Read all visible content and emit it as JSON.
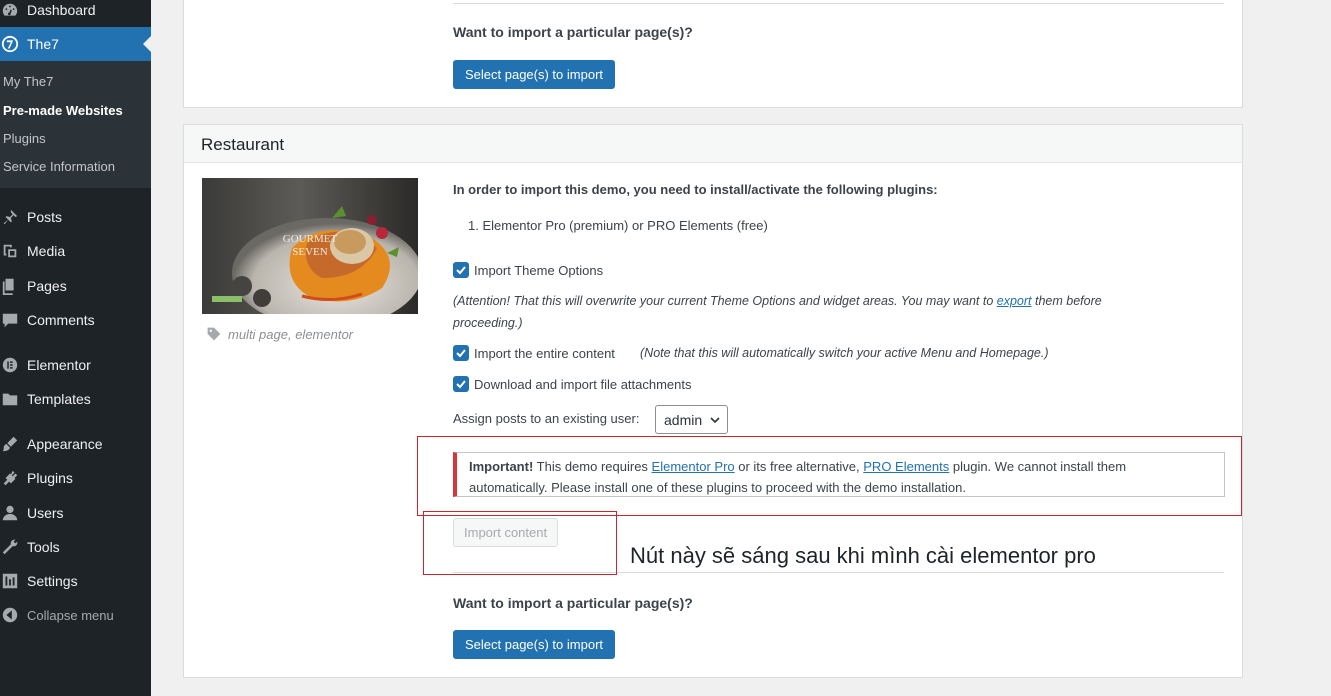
{
  "sidebar": {
    "dashboard": "Dashboard",
    "the7": "The7",
    "submenu": [
      "My The7",
      "Pre-made Websites",
      "Plugins",
      "Service Information"
    ],
    "items": [
      "Posts",
      "Media",
      "Pages",
      "Comments",
      "Elementor",
      "Templates",
      "Appearance",
      "Plugins",
      "Users",
      "Tools",
      "Settings"
    ],
    "collapse": "Collapse menu"
  },
  "top_panel": {
    "question": "Want to import a particular page(s)?",
    "select_button": "Select page(s) to import"
  },
  "restaurant": {
    "title": "Restaurant",
    "thumbnail": {
      "brand_line1": "GOURMET",
      "brand_line2": "SEVEN"
    },
    "tags": "multi page, elementor",
    "plugins_intro": "In order to import this demo, you need to install/activate the following plugins:",
    "plugin_list": [
      "1. Elementor Pro (premium) or PRO Elements (free)"
    ],
    "import_theme_options": "Import Theme Options",
    "attention_pre": "(Attention! That this will overwrite your current Theme Options and widget areas. You may want to ",
    "attention_link": "export",
    "attention_post": " them before",
    "attention_line2": "proceeding.)",
    "import_entire": "Import the entire content",
    "import_entire_note": "(Note that this will automatically switch your active Menu and Homepage.)",
    "download_attachments": "Download and import file attachments",
    "assign_label": "Assign posts to an existing user:",
    "assign_value": "admin",
    "notice": {
      "strong": "Important!",
      "text1": " This demo requires ",
      "link1": "Elementor Pro",
      "text2": " or its free alternative, ",
      "link2": "PRO Elements",
      "text3": " plugin. We cannot install them",
      "line2": "automatically. Please install one of these plugins to proceed with the demo installation."
    },
    "import_button": "Import content",
    "annotation": "Nút này sẽ sáng sau khi mình cài elementor pro",
    "question": "Want to import a particular page(s)?",
    "select_button": "Select page(s) to import"
  },
  "colors": {
    "primary": "#2271b1",
    "sidebar": "#1d2327",
    "notice_red": "#d63638",
    "annotation_red": "#c9252c"
  }
}
